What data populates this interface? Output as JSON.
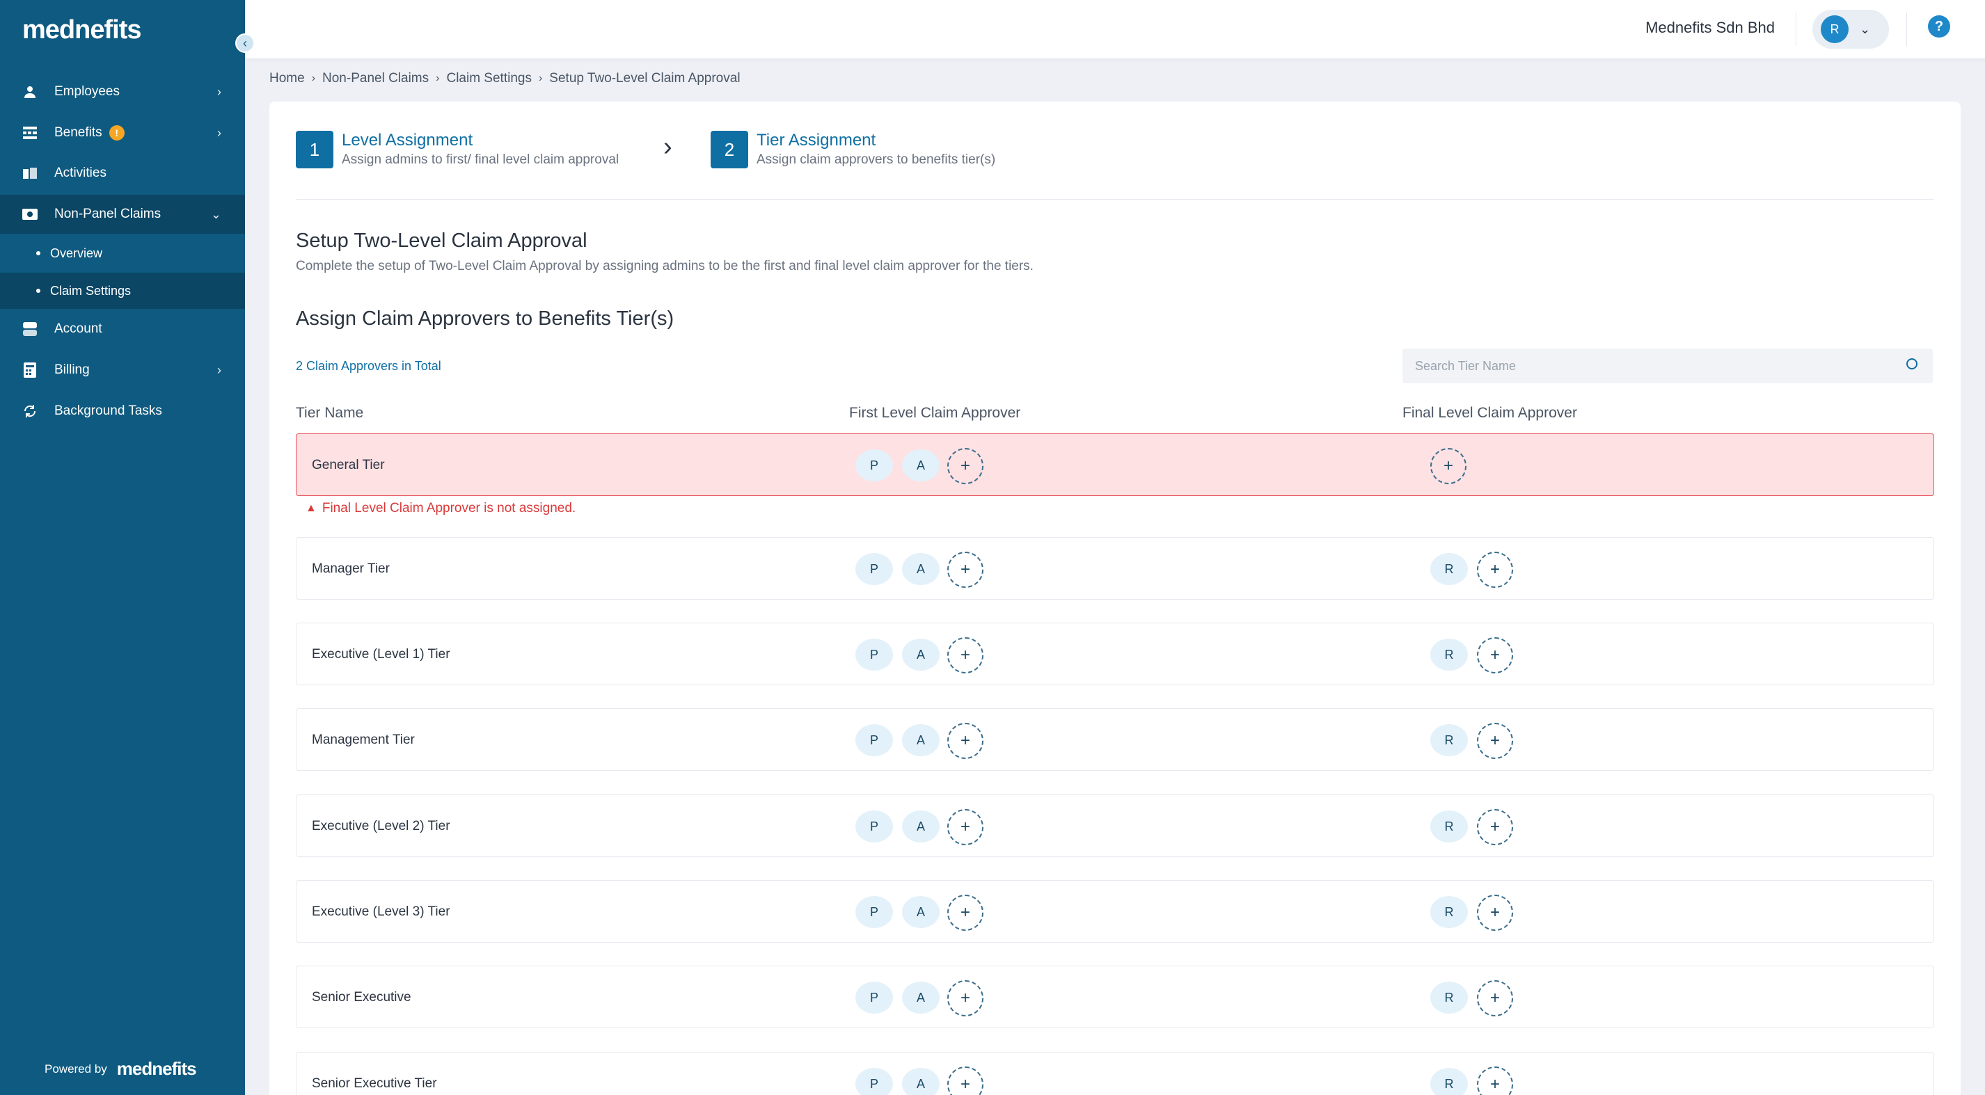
{
  "sidebar": {
    "logo": "mednefits",
    "items": [
      {
        "label": "Employees",
        "icon": "user-icon"
      },
      {
        "label": "Benefits",
        "icon": "benefits-icon",
        "badge": "!"
      },
      {
        "label": "Activities",
        "icon": "activities-icon"
      },
      {
        "label": "Non-Panel Claims",
        "icon": "claims-icon"
      },
      {
        "label": "Account",
        "icon": "account-icon"
      },
      {
        "label": "Billing",
        "icon": "billing-icon"
      },
      {
        "label": "Background Tasks",
        "icon": "sync-icon"
      }
    ],
    "sub_items": [
      "Overview",
      "Claim Settings"
    ],
    "powered_by": "Powered by",
    "powered_logo": "mednefits"
  },
  "header": {
    "company": "Mednefits Sdn Bhd",
    "avatar_initial": "R",
    "help": "?"
  },
  "breadcrumb": [
    "Home",
    "Non-Panel Claims",
    "Claim Settings",
    "Setup Two-Level Claim Approval"
  ],
  "steps": [
    {
      "number": "1",
      "title": "Level Assignment",
      "subtitle": "Assign admins to first/ final level claim approval"
    },
    {
      "number": "2",
      "title": "Tier Assignment",
      "subtitle": "Assign claim approvers to benefits tier(s)"
    }
  ],
  "main": {
    "title": "Setup Two-Level Claim Approval",
    "description": "Complete the setup of Two-Level Claim Approval by assigning admins to be the first and final level claim approver for the tiers.",
    "section_title": "Assign Claim Approvers to Benefits Tier(s)",
    "total_label": "2 Claim Approvers in Total",
    "search_placeholder": "Search Tier Name",
    "columns": [
      "Tier Name",
      "First Level Claim Approver",
      "Final Level Claim Approver"
    ],
    "error_message": "Final Level Claim Approver is not assigned.",
    "add_symbol": "+",
    "tiers": [
      {
        "name": "General Tier",
        "first": [
          "P",
          "A"
        ],
        "final": []
      },
      {
        "name": "Manager Tier",
        "first": [
          "P",
          "A"
        ],
        "final": [
          "R"
        ]
      },
      {
        "name": "Executive (Level 1) Tier",
        "first": [
          "P",
          "A"
        ],
        "final": [
          "R"
        ]
      },
      {
        "name": "Management Tier",
        "first": [
          "P",
          "A"
        ],
        "final": [
          "R"
        ]
      },
      {
        "name": "Executive (Level 2) Tier",
        "first": [
          "P",
          "A"
        ],
        "final": [
          "R"
        ]
      },
      {
        "name": "Executive (Level 3) Tier",
        "first": [
          "P",
          "A"
        ],
        "final": [
          "R"
        ]
      },
      {
        "name": "Senior Executive",
        "first": [
          "P",
          "A"
        ],
        "final": [
          "R"
        ]
      },
      {
        "name": "Senior Executive Tier",
        "first": [
          "P",
          "A"
        ],
        "final": [
          "R"
        ]
      }
    ]
  },
  "colors": {
    "sidebar_bg": "#0f5a80",
    "sidebar_active": "#0b4665",
    "accent": "#0f6fa3",
    "error": "#d93a3a",
    "error_bg": "#fde1e3"
  }
}
